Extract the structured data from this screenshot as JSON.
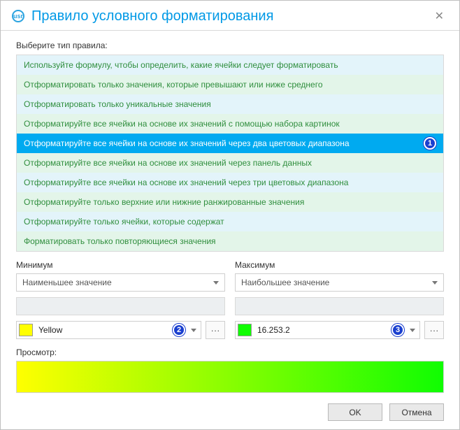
{
  "window": {
    "title": "Правило условного форматирования"
  },
  "sectionLabel": "Выберите тип правила:",
  "rules": [
    "Используйте формулу, чтобы определить, какие ячейки следует форматировать",
    "Отформатировать только значения, которые превышают или ниже среднего",
    "Отформатировать только уникальные значения",
    "Отформатируйте все ячейки на основе их значений с помощью набора картинок",
    "Отформатируйте все ячейки на основе их значений через два цветовых диапазона",
    "Отформатируйте все ячейки на основе их значений через панель данных",
    "Отформатируйте все ячейки на основе их значений через три цветовых диапазона",
    "Отформатируйте только верхние или нижние ранжированные значения",
    "Отформатируйте только ячейки, которые содержат",
    "Форматировать только повторяющиеся значения"
  ],
  "selectedRuleIndex": 4,
  "badges": {
    "rule": "1",
    "min": "2",
    "max": "3"
  },
  "min": {
    "label": "Минимум",
    "typeValue": "Наименьшее значение",
    "colorName": "Yellow",
    "colorHex": "#ffff00"
  },
  "max": {
    "label": "Максимум",
    "typeValue": "Наибольшее значение",
    "colorName": "16.253.2",
    "colorHex": "#10fd02"
  },
  "moreLabel": "···",
  "previewLabel": "Просмотр:",
  "buttons": {
    "ok": "OK",
    "cancel": "Отмена"
  }
}
